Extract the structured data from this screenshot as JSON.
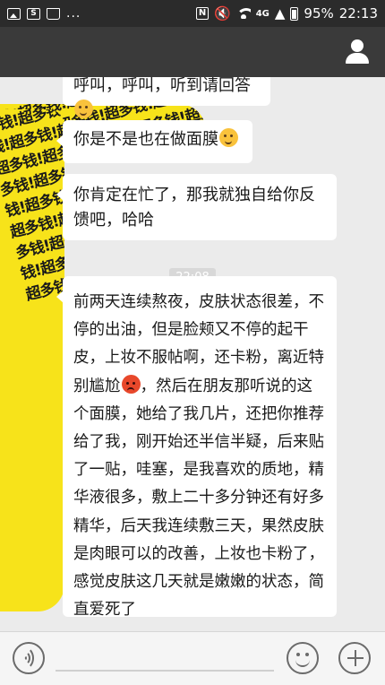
{
  "status_bar": {
    "left_icons": [
      "image-icon",
      "s-app-icon",
      "bag-icon"
    ],
    "more": "...",
    "network": "4G",
    "battery": "95%",
    "time": "22:13"
  },
  "header": {
    "profile_icon": "person-icon"
  },
  "avatar": {
    "pattern_text": "多钱!超多钱!超多钱!超多钱!超多钱!超多钱!超多钱!超多钱!超多钱!超多钱!超多钱!超多钱!超多钱!超多钱!超多钱!超多钱!超多钱!超多钱!超多钱!超多钱!超多钱!超多钱!超多钱!超多钱!超多钱!超多钱!超多钱!超多钱!超多钱!超多钱!超多钱!超多钱!超多钱!超多钱!超多钱!超多钱!超多钱!超多钱!超多钱!超多钱!超多钱!超多钱!超多钱!超多钱!超"
  },
  "messages": [
    {
      "text": "呼叫，呼叫，听到请回答",
      "emoji": "smile-emoji"
    },
    {
      "text": "你是不是也在做面膜",
      "emoji": "smile-emoji"
    },
    {
      "text": "你肯定在忙了，那我就独自给你反馈吧，哈哈"
    },
    {
      "text_before_emoji": "前两天连续熬夜，皮肤状态很差，不停的出油，但是脸颊又不停的起干皮，上妆不服帖啊，还卡粉，离近特别尴尬",
      "emoji": "angry-emoji",
      "text_after_emoji": "，然后在朋友那听说的这个面膜，她给了我几片，还把你推荐给了我，刚开始还半信半疑，后来贴了一贴，哇塞，是我喜欢的质地，精华液很多，敷上二十多分钟还有好多精华，后天我连续敷三天，果然皮肤是肉眼可以的改善，上妆也卡粉了，感觉皮肤这几天就是嫩嫩的状态，简直爱死了"
    }
  ],
  "timestamp": "22:08",
  "input_bar": {
    "voice_icon": "voice-icon",
    "emoji_icon": "emoji-icon",
    "plus_icon": "plus-icon"
  }
}
